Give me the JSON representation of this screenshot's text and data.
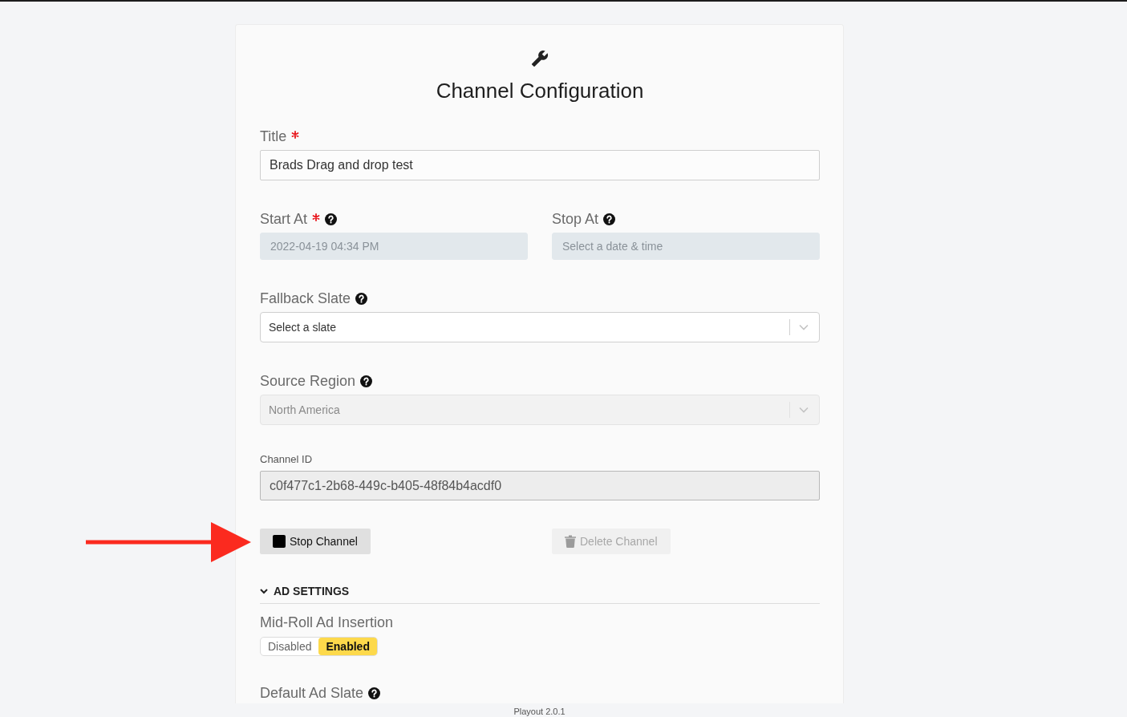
{
  "header": {
    "title": "Channel Configuration"
  },
  "form": [
    {
      "kind": "text",
      "label": "Title",
      "required": true,
      "help": false,
      "value": "Brads Drag and drop test"
    },
    {
      "kind": "pair",
      "fields": [
        {
          "kind": "datetime",
          "label": "Start At",
          "required": true,
          "help": true,
          "disabled": true,
          "value": "2022-04-19 04:34 PM"
        },
        {
          "kind": "datetime",
          "label": "Stop At",
          "required": false,
          "help": true,
          "disabled": true,
          "placeholder": "Select a date & time"
        }
      ]
    },
    {
      "kind": "select",
      "label": "Fallback Slate",
      "required": false,
      "help": true,
      "disabled": false,
      "placeholder": "Select a slate"
    },
    {
      "kind": "select",
      "label": "Source Region",
      "required": false,
      "help": true,
      "disabled": true,
      "value": "North America"
    },
    {
      "kind": "readonly",
      "label": "Channel ID",
      "required": false,
      "help": false,
      "value": "c0f477c1-2b68-449c-b405-48f84b4acdf0"
    }
  ],
  "actions": [
    {
      "kind": "stop",
      "label": "Stop Channel",
      "disabled": false
    },
    {
      "kind": "delete",
      "label": "Delete Channel",
      "disabled": true
    }
  ],
  "ad_settings": {
    "title": "AD SETTINGS",
    "expanded": true,
    "fields": [
      {
        "kind": "toggle",
        "label": "Mid-Roll Ad Insertion",
        "required": false,
        "help": false,
        "options": [
          {
            "label": "Disabled",
            "selected": false
          },
          {
            "label": "Enabled",
            "selected": true
          }
        ]
      },
      {
        "kind": "label",
        "label": "Default Ad Slate",
        "required": false,
        "help": true
      }
    ]
  },
  "annotation": {
    "kind": "arrow"
  },
  "footer": {
    "version": "Playout 2.0.1"
  }
}
